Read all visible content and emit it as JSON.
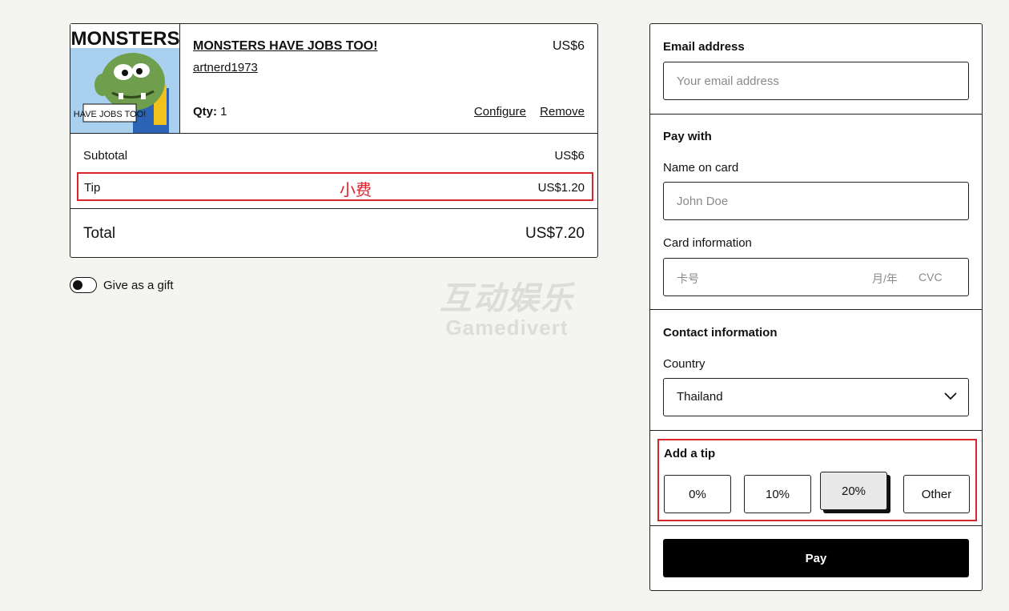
{
  "cart": {
    "item": {
      "thumb_top_text": "MONSTERS",
      "thumb_bottom_text": "HAVE JOBS TOO!",
      "title": "MONSTERS HAVE JOBS TOO!",
      "price": "US$6",
      "artist": "artnerd1973",
      "qty_label": "Qty:",
      "qty_value": "1",
      "configure_label": "Configure",
      "remove_label": "Remove"
    },
    "subtotal_label": "Subtotal",
    "subtotal_value": "US$6",
    "tip_label": "Tip",
    "tip_annotation": "小费",
    "tip_value": "US$1.20",
    "total_label": "Total",
    "total_value": "US$7.20"
  },
  "gift": {
    "label": "Give as a gift",
    "enabled": false
  },
  "watermark": {
    "line1": "互动娱乐",
    "line2": "Gamedivert"
  },
  "form": {
    "email": {
      "label": "Email address",
      "placeholder": "Your email address"
    },
    "pay_with": {
      "heading": "Pay with",
      "name_label": "Name on card",
      "name_placeholder": "John Doe",
      "card_label": "Card information",
      "card_number_placeholder": "卡号",
      "card_expiry_placeholder": "月/年",
      "card_cvc_placeholder": "CVC"
    },
    "contact": {
      "heading": "Contact information",
      "country_label": "Country",
      "country_value": "Thailand"
    },
    "tip": {
      "heading": "Add a tip",
      "options": [
        "0%",
        "10%",
        "20%",
        "Other"
      ],
      "selected": "20%"
    },
    "pay_label": "Pay"
  },
  "colors": {
    "accent_red": "#d9262c",
    "primary": "#000000",
    "background": "#f4f4f0"
  }
}
